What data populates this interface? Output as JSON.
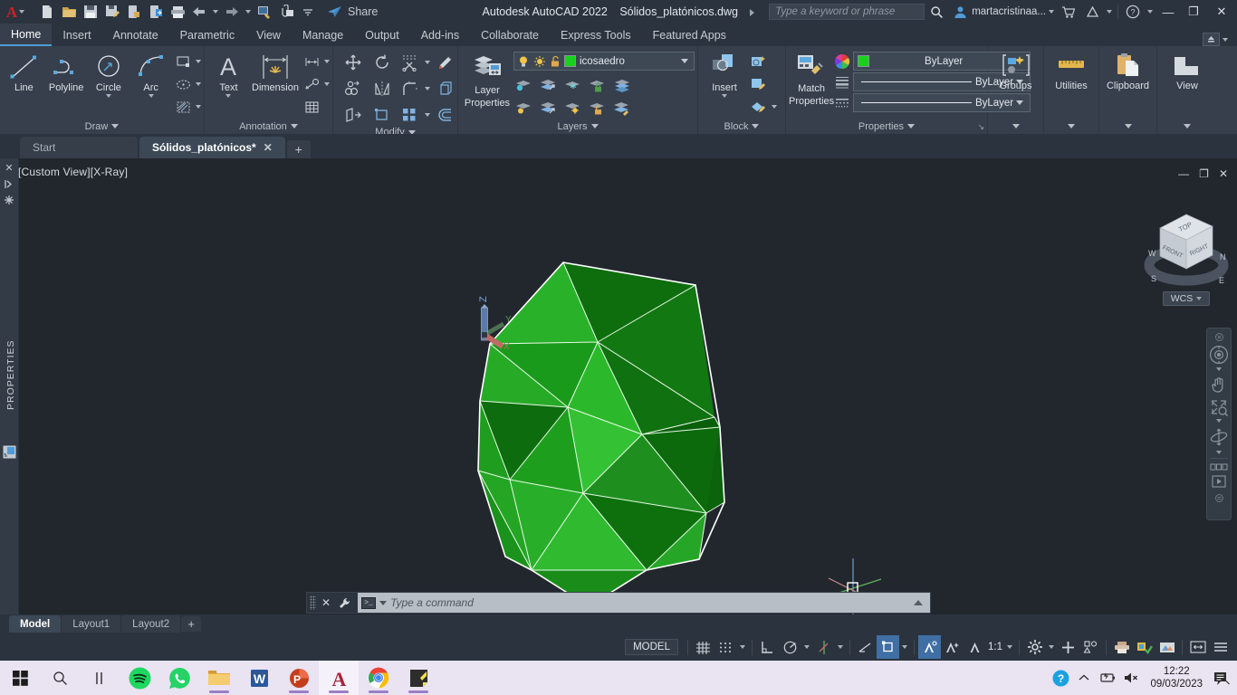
{
  "titlebar": {
    "app_menu": "A",
    "quick_access": [
      {
        "name": "new-file-icon",
        "label": "New"
      },
      {
        "name": "open-file-icon",
        "label": "Open"
      },
      {
        "name": "save-icon",
        "label": "Save"
      },
      {
        "name": "save-as-icon",
        "label": "Save As"
      },
      {
        "name": "save-to-web-icon",
        "label": "Save to Web & Mobile"
      },
      {
        "name": "open-from-web-icon",
        "label": "Open from Web & Mobile"
      },
      {
        "name": "plot-icon",
        "label": "Plot"
      },
      {
        "name": "undo-icon",
        "label": "Undo"
      },
      {
        "name": "redo-icon",
        "label": "Redo"
      },
      {
        "name": "batch-plot-icon",
        "label": "Batch Plot"
      },
      {
        "name": "attach-icon",
        "label": "Attach"
      },
      {
        "name": "qat-more-icon",
        "label": "Customize"
      }
    ],
    "share_label": "Share",
    "app_title": "Autodesk AutoCAD 2022",
    "document_name": "Sólidos_platónicos.dwg",
    "search_placeholder": "Type a keyword or phrase",
    "username": "martacristinaa...",
    "window_minimize": "—",
    "window_restore": "❐",
    "window_close": "✕"
  },
  "ribbon_tabs": [
    {
      "label": "Home",
      "active": true
    },
    {
      "label": "Insert",
      "active": false
    },
    {
      "label": "Annotate",
      "active": false
    },
    {
      "label": "Parametric",
      "active": false
    },
    {
      "label": "View",
      "active": false
    },
    {
      "label": "Manage",
      "active": false
    },
    {
      "label": "Output",
      "active": false
    },
    {
      "label": "Add-ins",
      "active": false
    },
    {
      "label": "Collaborate",
      "active": false
    },
    {
      "label": "Express Tools",
      "active": false
    },
    {
      "label": "Featured Apps",
      "active": false
    }
  ],
  "ribbon": {
    "draw": {
      "title": "Draw",
      "line": "Line",
      "polyline": "Polyline",
      "circle": "Circle",
      "arc": "Arc"
    },
    "annotation": {
      "title": "Annotation",
      "text": "Text",
      "dimension": "Dimension"
    },
    "modify": {
      "title": "Modify"
    },
    "layers": {
      "title": "Layers",
      "layer_properties": "Layer",
      "layer_properties2": "Properties",
      "current_layer": "icosaedro",
      "layer_color": "#1ad11a"
    },
    "block": {
      "title": "Block",
      "insert": "Insert"
    },
    "properties": {
      "title": "Properties",
      "match_properties": "Match",
      "match_properties2": "Properties",
      "color_value": "ByLayer",
      "linetype_value": "ByLayer",
      "lineweight_value": "ByLayer",
      "color_swatch": "#1ad11a"
    },
    "groups": {
      "title": "Groups"
    },
    "utilities": {
      "title": "Utilities"
    },
    "clipboard": {
      "title": "Clipboard"
    },
    "view": {
      "title": "View"
    }
  },
  "file_tabs": [
    {
      "label": "Start",
      "active": false,
      "closable": false
    },
    {
      "label": "Sólidos_platónicos*",
      "active": true,
      "closable": true
    }
  ],
  "file_tab_add": "+",
  "canvas": {
    "view_label": "[Custom View][X-Ray]",
    "viewport_minimize": "—",
    "viewport_restore": "❐",
    "viewport_close": "✕",
    "background_color": "#22272e",
    "ucs": {
      "z": "Z",
      "y": "Y",
      "x": "X"
    },
    "viewcube": {
      "top": "TOP",
      "front": "FRONT",
      "right": "RIGHT",
      "north": "N",
      "east": "E",
      "south": "S",
      "west": "W"
    },
    "wcs_button": "WCS",
    "navbar": [
      {
        "name": "navbar-close-icon",
        "label": "Close"
      },
      {
        "name": "steering-wheel-icon",
        "label": "Full Navigation Wheel"
      },
      {
        "name": "pan-icon",
        "label": "Pan"
      },
      {
        "name": "zoom-extents-icon",
        "label": "Zoom Extents"
      },
      {
        "name": "orbit-icon",
        "label": "Orbit"
      },
      {
        "name": "showmotion-icon",
        "label": "ShowMotion"
      },
      {
        "name": "navbar-menu-icon",
        "label": "Customize"
      }
    ]
  },
  "model": {
    "name": "icosahedron",
    "edge_color": "#ffffff",
    "face_colors": [
      "#1f9e1f",
      "#26b326",
      "#158515",
      "#0f7a0f",
      "#2dbf2d",
      "#18901a"
    ]
  },
  "properties_palette": {
    "title": "PROPERTIES",
    "close": "✕"
  },
  "command_line": {
    "placeholder": "Type a command",
    "close": "✕"
  },
  "layout_tabs": [
    {
      "label": "Model",
      "active": true
    },
    {
      "label": "Layout1",
      "active": false
    },
    {
      "label": "Layout2",
      "active": false
    }
  ],
  "layout_tab_add": "+",
  "status_bar": {
    "model_space": "MODEL",
    "annotation_scale": "1:1",
    "items": [
      {
        "name": "grid-display-icon",
        "label": "Display Drawing Grid",
        "on": false
      },
      {
        "name": "snap-mode-icon",
        "label": "Snap Mode",
        "on": false
      },
      {
        "name": "ortho-mode-icon",
        "label": "Ortho Mode",
        "on": false
      },
      {
        "name": "polar-tracking-icon",
        "label": "Polar Tracking",
        "on": false
      },
      {
        "name": "object-snap-tracking-icon",
        "label": "Object Snap Tracking",
        "on": false
      },
      {
        "name": "object-snap-icon",
        "label": "Object Snap",
        "on": false
      },
      {
        "name": "lineweight-icon",
        "label": "Show/Hide Lineweight",
        "on": false
      },
      {
        "name": "transparency-icon",
        "label": "Show/Hide Transparency",
        "on": false
      },
      {
        "name": "annotation-visibility-icon",
        "label": "Annotation Visibility",
        "on": true
      },
      {
        "name": "autoscale-icon",
        "label": "Autoscale",
        "on": false
      },
      {
        "name": "annotation-scale-icon",
        "label": "Annotation Scale",
        "on": false
      },
      {
        "name": "workspace-switching-icon",
        "label": "Workspace Switching",
        "on": false
      },
      {
        "name": "customization-icon",
        "label": "Customization",
        "on": false
      },
      {
        "name": "isolate-objects-icon",
        "label": "Isolate Objects",
        "on": false
      },
      {
        "name": "hardware-acceleration-icon",
        "label": "Hardware Acceleration",
        "on": false
      },
      {
        "name": "clean-screen-icon",
        "label": "Clean Screen",
        "on": false
      }
    ]
  },
  "taskbar": {
    "apps": [
      {
        "name": "start-button-icon",
        "label": "Start",
        "running": false,
        "active": false
      },
      {
        "name": "search-icon",
        "label": "Search",
        "running": false,
        "active": false
      },
      {
        "name": "task-view-icon",
        "label": "Task View",
        "running": false,
        "active": false
      },
      {
        "name": "spotify-icon",
        "label": "Spotify",
        "running": false,
        "active": false
      },
      {
        "name": "whatsapp-icon",
        "label": "WhatsApp",
        "running": false,
        "active": false
      },
      {
        "name": "file-explorer-icon",
        "label": "File Explorer",
        "running": true,
        "active": false
      },
      {
        "name": "word-icon",
        "label": "Microsoft Word",
        "running": false,
        "active": false
      },
      {
        "name": "powerpoint-icon",
        "label": "Microsoft PowerPoint",
        "running": true,
        "active": false
      },
      {
        "name": "autocad-icon",
        "label": "AutoCAD",
        "running": true,
        "active": true
      },
      {
        "name": "chrome-icon",
        "label": "Google Chrome",
        "running": true,
        "active": false
      },
      {
        "name": "sticky-notes-icon",
        "label": "Sticky Notes",
        "running": false,
        "active": false
      }
    ],
    "tray": {
      "help": "?",
      "time": "12:22",
      "date": "09/03/2023"
    }
  }
}
